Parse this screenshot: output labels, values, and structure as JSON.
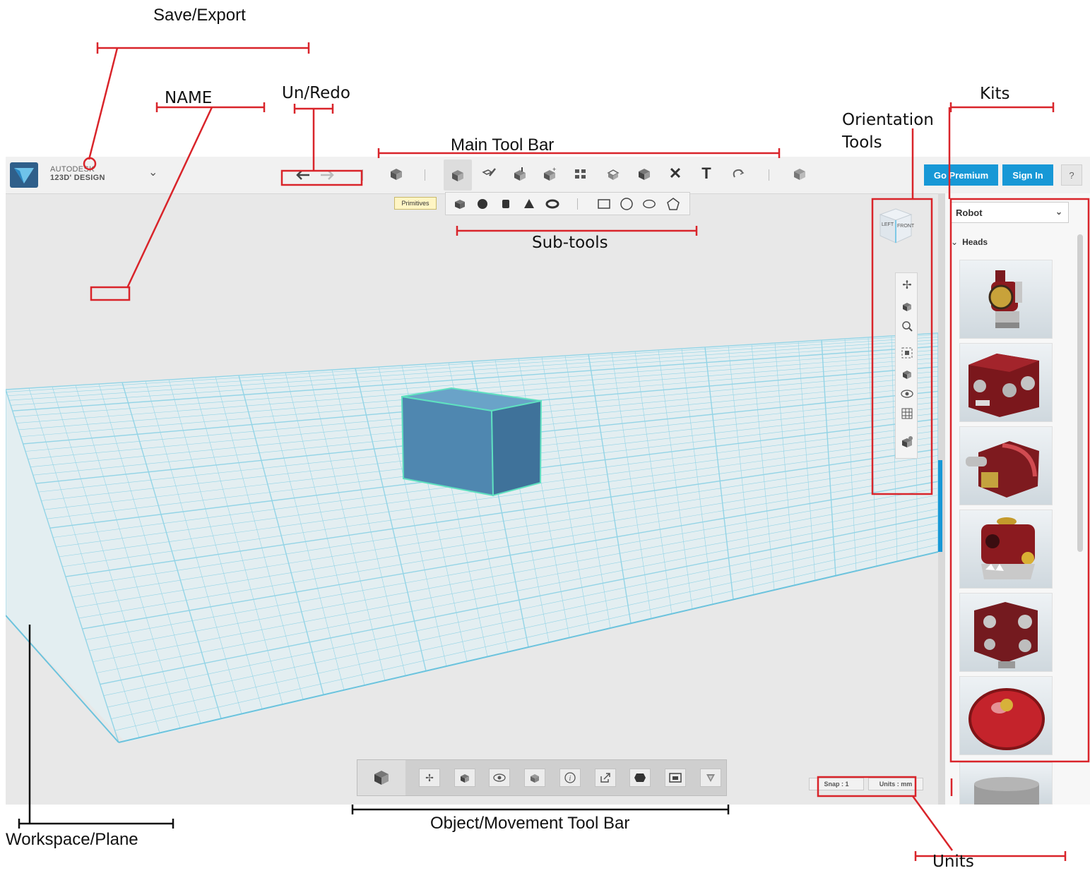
{
  "app": {
    "brand_line1": "AUTODESK",
    "brand_line2": "123D' DESIGN",
    "logo_icon": "autodesk-logo-icon",
    "menu_chevron": "⌄",
    "undo_icon": "undo-arrow-icon",
    "redo_icon": "redo-arrow-icon",
    "toolbar_icons": [
      "new-object-icon",
      "primitives-icon",
      "sketch-icon",
      "construct-icon",
      "modify-icon",
      "pattern-icon",
      "group-icon",
      "combine-icon",
      "delete-icon",
      "text-icon",
      "snap-icon",
      "material-icon"
    ],
    "delete_glyph": "✕",
    "text_glyph": "T",
    "go_premium": "Go Premium",
    "sign_in": "Sign In",
    "help": "?"
  },
  "subtools": {
    "label": "Primitives",
    "solid_icons": [
      "box-icon",
      "sphere-icon",
      "cylinder-icon",
      "cone-icon",
      "torus-icon"
    ],
    "shape_icons": [
      "rectangle-icon",
      "circle-icon",
      "ellipse-icon",
      "polygon-icon"
    ]
  },
  "viewcube": {
    "left_face": "LEFT",
    "front_face": "FRONT"
  },
  "orientation": {
    "icons": [
      "pan-icon",
      "orbit-icon",
      "zoom-icon",
      "fit-icon",
      "view-icon",
      "visibility-icon",
      "grid-icon",
      "material-view-icon"
    ]
  },
  "kits": {
    "selected": "Robot",
    "section": "Heads",
    "items": [
      "robot-head-1",
      "robot-head-2",
      "robot-head-3",
      "robot-head-4",
      "robot-head-5",
      "robot-head-6",
      "robot-head-7"
    ]
  },
  "bottom_toolbar": {
    "icons": [
      "object-icon",
      "move-icon",
      "smart-scale-icon",
      "hide-icon",
      "solid-icon",
      "info-icon",
      "export-icon",
      "material-icon",
      "snapshot-icon",
      "measure-icon"
    ]
  },
  "status": {
    "snap": "Snap : 1",
    "units": "Units : mm"
  },
  "annotations": {
    "save_export": "Save/Export",
    "name": "NAME",
    "un_redo": "Un/Redo",
    "main_tool_bar": "Main Tool Bar",
    "sub_tools": "Sub-tools",
    "orientation_1": "Orientation",
    "orientation_2": "Tools",
    "kits": "Kits",
    "object_movement": "Object/Movement Tool Bar",
    "workspace": "Workspace/Plane",
    "units": "Units"
  },
  "colors": {
    "accent_blue": "#1798d6",
    "grid_line": "#8fd3e6",
    "cube": "#4a86b2",
    "annotation_red": "#d9242a",
    "robot_red": "#8b1a1f"
  }
}
